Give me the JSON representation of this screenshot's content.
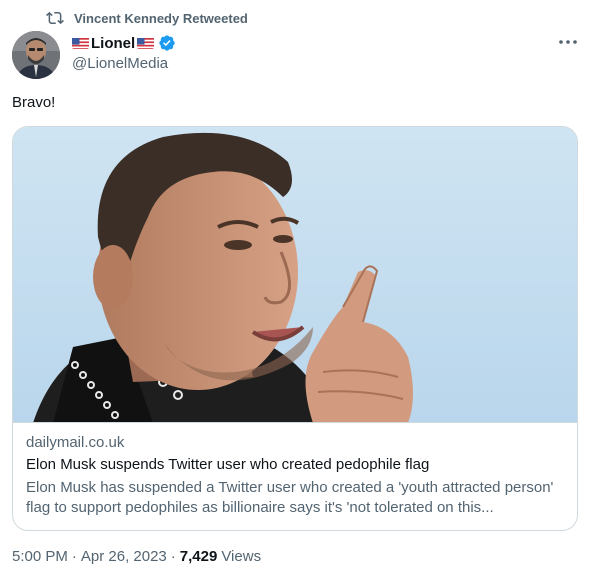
{
  "social_context": {
    "icon": "retweet-icon",
    "text": "Vincent Kennedy Retweeted"
  },
  "author": {
    "display_name": "Lionel",
    "handle": "@LionelMedia",
    "name_decorations": [
      "us-flag-icon",
      "us-flag-icon"
    ],
    "verified": true,
    "verified_color": "#1d9bf0"
  },
  "tweet": {
    "text": "Bravo!"
  },
  "link_card": {
    "domain": "dailymail.co.uk",
    "title": "Elon Musk suspends Twitter user who created pedophile flag",
    "description": "Elon Musk has suspended a Twitter user who created a 'youth attracted person' flag to support pedophiles as billionaire says it's 'not tolerated on this..."
  },
  "meta": {
    "time": "5:00 PM",
    "separator": "·",
    "date": "Apr 26, 2023",
    "views_count": "7,429",
    "views_label": "Views"
  },
  "colors": {
    "secondary_text": "#536471",
    "primary_text": "#0f1419",
    "border": "#cfd9de",
    "accent": "#1d9bf0"
  }
}
